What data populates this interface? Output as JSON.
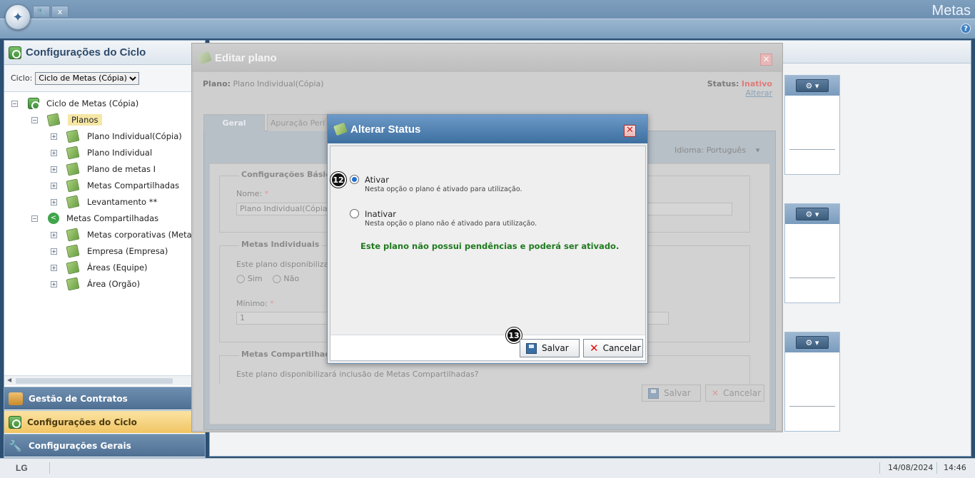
{
  "app": {
    "title": "Metas",
    "help": "?",
    "toolbar_close": "x"
  },
  "left_panel": {
    "title": "Configurações do Ciclo",
    "cycle_label": "Ciclo:",
    "cycle_value": "Ciclo de Metas (Cópia)",
    "tree": {
      "root": "Ciclo de Metas (Cópia)",
      "planos": "Planos",
      "planos_children": [
        "Plano Individual(Cópia)",
        "Plano Individual",
        "Plano de metas I",
        "Metas Compartilhadas",
        "Levantamento **"
      ],
      "shared": "Metas Compartilhadas",
      "shared_children": [
        "Metas corporativas (Metas corp",
        "Empresa (Empresa)",
        "Áreas (Equipe)",
        "Área (Orgão)"
      ]
    },
    "accordion": [
      "Gestão de Contratos",
      "Configurações do Ciclo",
      "Configurações Gerais"
    ]
  },
  "edit_dialog": {
    "title": "Editar plano",
    "plano_label": "Plano:",
    "plano_value": "Plano Individual(Cópia)",
    "status_label": "Status:",
    "status_value": "Inativo",
    "alterar": "Alterar",
    "tabs": [
      "Geral",
      "Apuração Peri"
    ],
    "idioma_label": "Idioma:",
    "idioma_value": "Português",
    "section_config": "Configurações Básicas",
    "nome_label": "Nome:",
    "nome_value": "Plano Individual(Cópia)",
    "section_individuais": "Metas Individuais",
    "individuais_question": "Este plano disponibilizará i",
    "sim": "Sim",
    "nao": "Não",
    "minimo_label": "Mínimo:",
    "minimo_value": "1",
    "section_compartilhadas": "Metas Compartilhadas",
    "compartilhadas_question": "Este plano disponibilizará inclusão de Metas Compartilhadas?",
    "save": "Salvar",
    "cancel": "Cancelar"
  },
  "status_dialog": {
    "title": "Alterar Status",
    "options": [
      {
        "label": "Ativar",
        "desc": "Nesta opção o plano é ativado para utilização.",
        "selected": true
      },
      {
        "label": "Inativar",
        "desc": "Nesta opção o plano não é ativado para utilização.",
        "selected": false
      }
    ],
    "message": "Este plano não possui pendências e poderá ser ativado.",
    "save": "Salvar",
    "cancel": "Cancelar",
    "badge_radio": "12",
    "badge_save": "13"
  },
  "statusbar": {
    "brand": "LG",
    "date": "14/08/2024",
    "time": "14:46"
  },
  "colors": {
    "accent": "#3d6f9f",
    "message_green": "#1f7a1f",
    "status_inactive": "#e07a7a"
  }
}
